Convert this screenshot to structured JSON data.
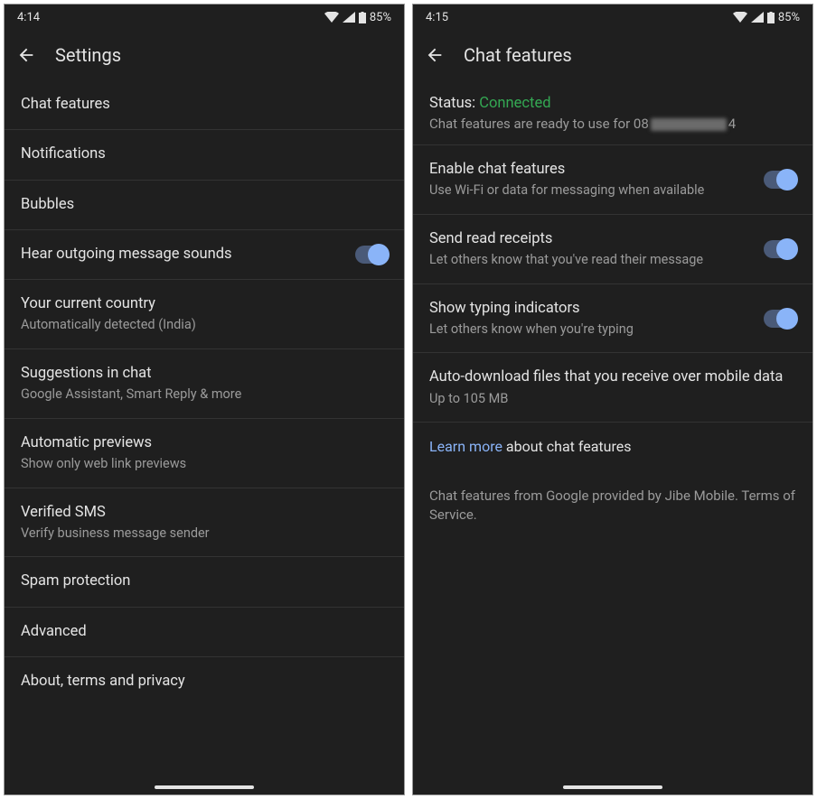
{
  "left": {
    "status_bar": {
      "time": "4:14",
      "battery": "85%"
    },
    "app_bar": {
      "title": "Settings"
    },
    "rows": [
      {
        "primary": "Chat features"
      },
      {
        "primary": "Notifications"
      },
      {
        "primary": "Bubbles"
      },
      {
        "primary": "Hear outgoing message sounds",
        "toggle": true
      },
      {
        "primary": "Your current country",
        "secondary": "Automatically detected (India)"
      },
      {
        "primary": "Suggestions in chat",
        "secondary": "Google Assistant, Smart Reply & more"
      },
      {
        "primary": "Automatic previews",
        "secondary": "Show only web link previews"
      },
      {
        "primary": "Verified SMS",
        "secondary": "Verify business message sender"
      },
      {
        "primary": "Spam protection"
      },
      {
        "primary": "Advanced"
      },
      {
        "primary": "About, terms and privacy"
      }
    ]
  },
  "right": {
    "status_bar": {
      "time": "4:15",
      "battery": "85%"
    },
    "app_bar": {
      "title": "Chat features"
    },
    "status_block": {
      "label": "Status:",
      "value": "Connected",
      "ready_prefix": "Chat features are ready to use for 08",
      "ready_suffix": "4"
    },
    "rows": [
      {
        "primary": "Enable chat features",
        "secondary": "Use Wi-Fi or data for messaging when available",
        "toggle": true
      },
      {
        "primary": "Send read receipts",
        "secondary": "Let others know that you've read their message",
        "toggle": true
      },
      {
        "primary": "Show typing indicators",
        "secondary": "Let others know when you're typing",
        "toggle": true
      },
      {
        "primary": "Auto-download files that you receive over mobile data",
        "secondary": "Up to 105 MB"
      }
    ],
    "learn_more": {
      "link": "Learn more",
      "rest": " about chat features"
    },
    "footer": "Chat features from Google provided by Jibe Mobile. Terms of Service."
  }
}
